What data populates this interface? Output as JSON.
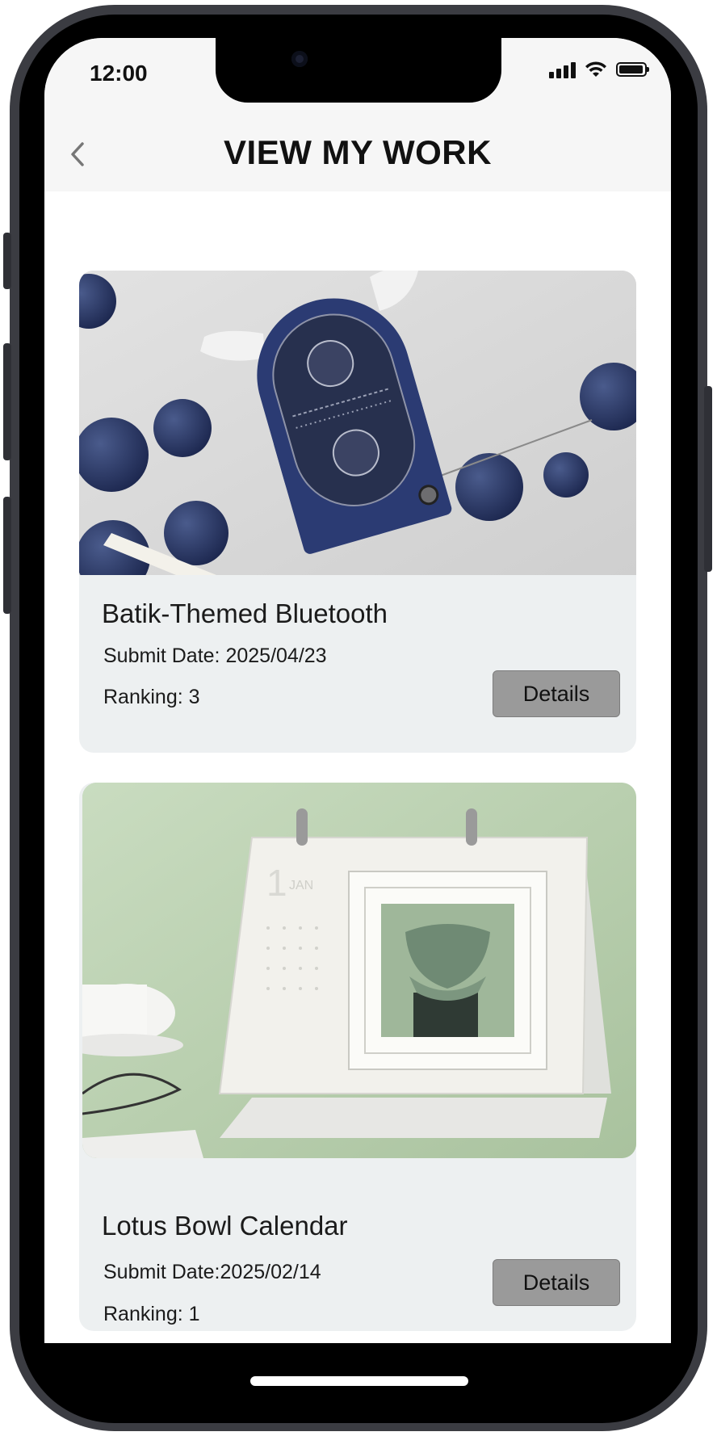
{
  "status_bar": {
    "time": "12:00"
  },
  "header": {
    "title": "VIEW MY WORK"
  },
  "works": [
    {
      "title": "Batik-Themed Bluetooth",
      "submit_date": "Submit Date: 2025/04/23",
      "ranking": "Ranking: 3",
      "details_label": "Details"
    },
    {
      "title": "Lotus Bowl Calendar",
      "submit_date": "Submit Date:2025/02/14",
      "ranking": "Ranking: 1",
      "details_label": "Details"
    }
  ]
}
